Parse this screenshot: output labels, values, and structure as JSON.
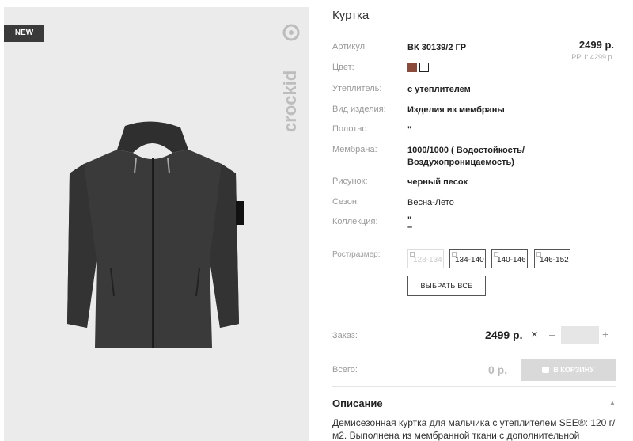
{
  "badge": "NEW",
  "brand": "crockid",
  "product": {
    "title": "Куртка",
    "price": "2499 р.",
    "rrc": "РРЦ: 4299 р."
  },
  "specs": {
    "article_label": "Артикул:",
    "article_value": "ВК 30139/2 ГР",
    "color_label": "Цвет:",
    "colors": [
      "#8b4a3a",
      "#111111"
    ],
    "insulation_label": "Утеплитель:",
    "insulation_value": "с утеплителем",
    "type_label": "Вид изделия:",
    "type_value": "Изделия из мембраны",
    "fabric_label": "Полотно:",
    "fabric_value": "\"",
    "membrane_label": "Мембрана:",
    "membrane_value": "1000/1000 ( Водостойкость/ Воздухопроницаемость)",
    "pattern_label": "Рисунок:",
    "pattern_value": "черный песок",
    "season_label": "Сезон:",
    "season_value": "Весна-Лето",
    "collection_label": "Коллекция:",
    "collection_value": "\"\n–",
    "size_label": "Рост/размер:"
  },
  "sizes": [
    "128-134",
    "134-140",
    "140-146",
    "146-152"
  ],
  "select_all": "ВЫБРАТЬ ВСЕ",
  "order": {
    "label": "Заказ:",
    "price": "2499 р.",
    "times": "×",
    "minus": "–",
    "qty": "",
    "plus": "+"
  },
  "total": {
    "label": "Всего:",
    "value": "0 р.",
    "cart_button": "В КОРЗИНУ"
  },
  "description": {
    "title": "Описание",
    "arrow": "▲",
    "text": "Демисезонная куртка для мальчика с утеплителем SEE®: 120 г/м2. Выполнена из мембранной ткани с дополнительной тефлоновой"
  }
}
